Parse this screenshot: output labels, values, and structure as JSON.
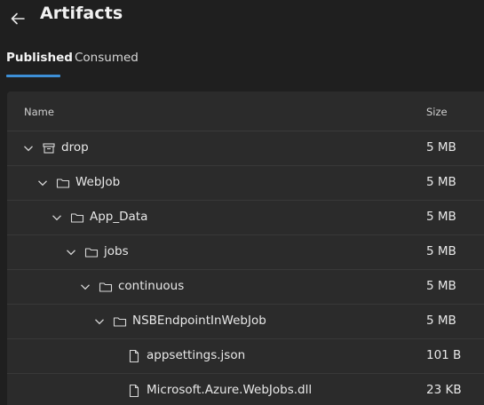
{
  "header": {
    "title": "Artifacts",
    "back_icon": "arrow-left-icon"
  },
  "tabs": [
    {
      "label": "Published",
      "active": true
    },
    {
      "label": "Consumed",
      "active": false
    }
  ],
  "accent_color": "#3d8fd6",
  "table": {
    "columns": {
      "name": "Name",
      "size": "Size"
    },
    "rows": [
      {
        "name": "drop",
        "size": "5 MB",
        "type": "artifact",
        "expanded": true
      },
      {
        "name": "WebJob",
        "size": "5 MB",
        "type": "folder",
        "expanded": true
      },
      {
        "name": "App_Data",
        "size": "5 MB",
        "type": "folder",
        "expanded": true
      },
      {
        "name": "jobs",
        "size": "5 MB",
        "type": "folder",
        "expanded": true
      },
      {
        "name": "continuous",
        "size": "5 MB",
        "type": "folder",
        "expanded": true
      },
      {
        "name": "NSBEndpointInWebJob",
        "size": "5 MB",
        "type": "folder",
        "expanded": true
      },
      {
        "name": "appsettings.json",
        "size": "101 B",
        "type": "file"
      },
      {
        "name": "Microsoft.Azure.WebJobs.dll",
        "size": "23 KB",
        "type": "file"
      }
    ]
  }
}
